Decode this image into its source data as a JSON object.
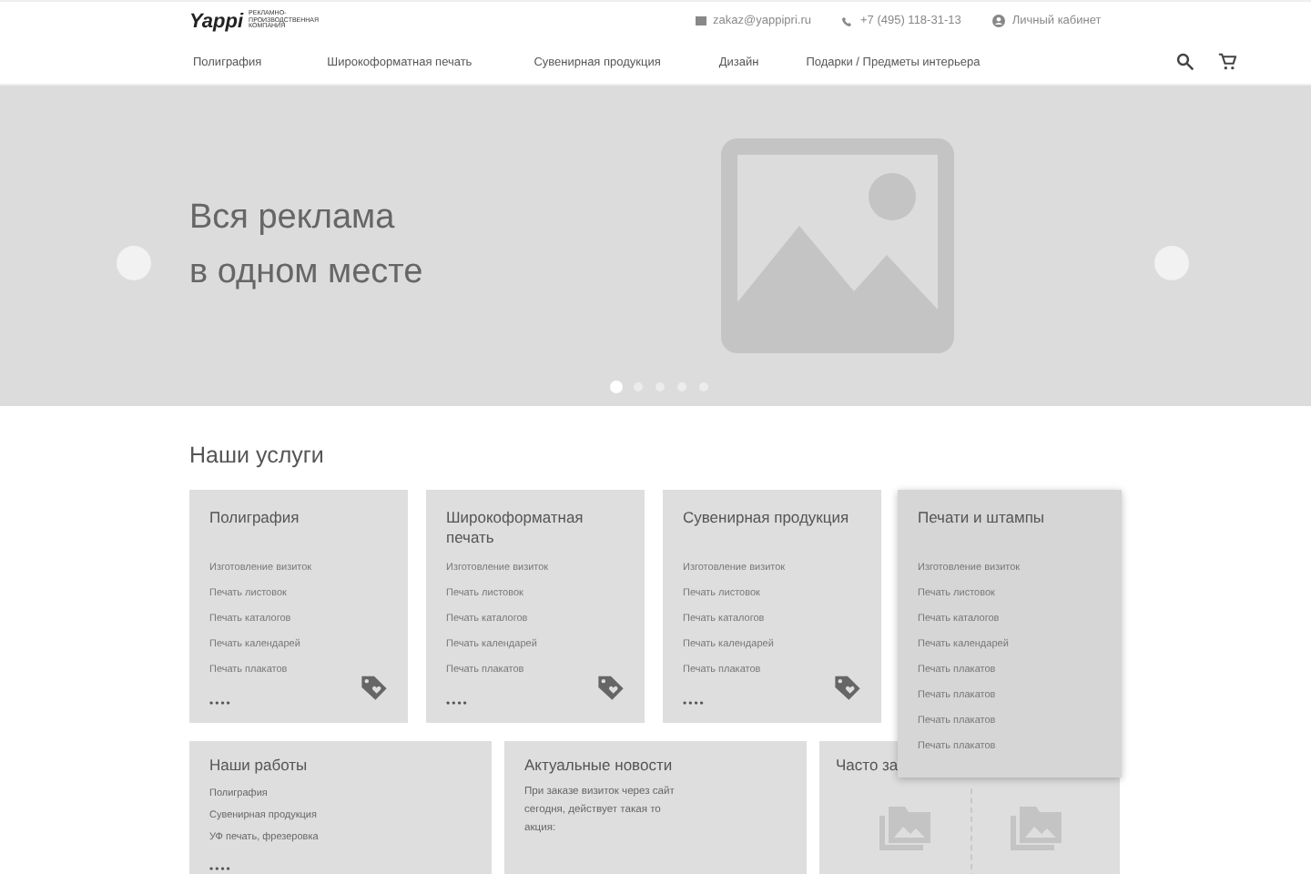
{
  "header": {
    "logo": "Yappi",
    "tagline": "РЕКЛАМНО-ПРОИЗВОДСТВЕННАЯ КОМПАНИЯ",
    "email": "zakaz@yappipri.ru",
    "phone": "+7 (495) 118-31-13",
    "account": "Личный кабинет"
  },
  "nav": [
    "Полиграфия",
    "Широкоформатная печать",
    "Сувенирная продукция",
    "Дизайн",
    "Подарки / Предметы интерьера"
  ],
  "hero": {
    "headline": [
      "Вся реклама",
      "в одном месте"
    ],
    "slides": [
      {
        "selected": true
      },
      {
        "selected": false
      },
      {
        "selected": false
      },
      {
        "selected": false
      },
      {
        "selected": false
      }
    ]
  },
  "services": {
    "title": "Наши услуги",
    "cards": [
      {
        "title": "Полиграфия",
        "items": [
          "Изготовление визиток",
          "Печать листовок",
          "Печать каталогов",
          "Печать календарей",
          "Печать плакатов"
        ],
        "more": "••••",
        "expanded": false
      },
      {
        "title": "Широкоформатная печать",
        "items": [
          "Изготовление визиток",
          "Печать листовок",
          "Печать каталогов",
          "Печать календарей",
          "Печать плакатов"
        ],
        "more": "••••",
        "expanded": false
      },
      {
        "title": "Сувенирная продукция",
        "items": [
          "Изготовление визиток",
          "Печать листовок",
          "Печать каталогов",
          "Печать календарей",
          "Печать плакатов"
        ],
        "more": "••••",
        "expanded": false
      },
      {
        "title": "Печати и штампы",
        "items": [
          "Изготовление визиток",
          "Печать листовок",
          "Печать каталогов",
          "Печать календарей",
          "Печать плакатов",
          "Печать плакатов",
          "Печать плакатов",
          "Печать плакатов"
        ],
        "expanded": true
      }
    ]
  },
  "works": {
    "title": "Наши работы",
    "items": [
      "Полиграфия",
      "Сувенирная продукция",
      "УФ печать, фрезеровка"
    ],
    "more": "••••"
  },
  "news": {
    "title": "Актуальные новости",
    "text": "При заказе визиток через сайт сегодня, действует такая то акция:"
  },
  "faq": {
    "title": "Часто за"
  }
}
